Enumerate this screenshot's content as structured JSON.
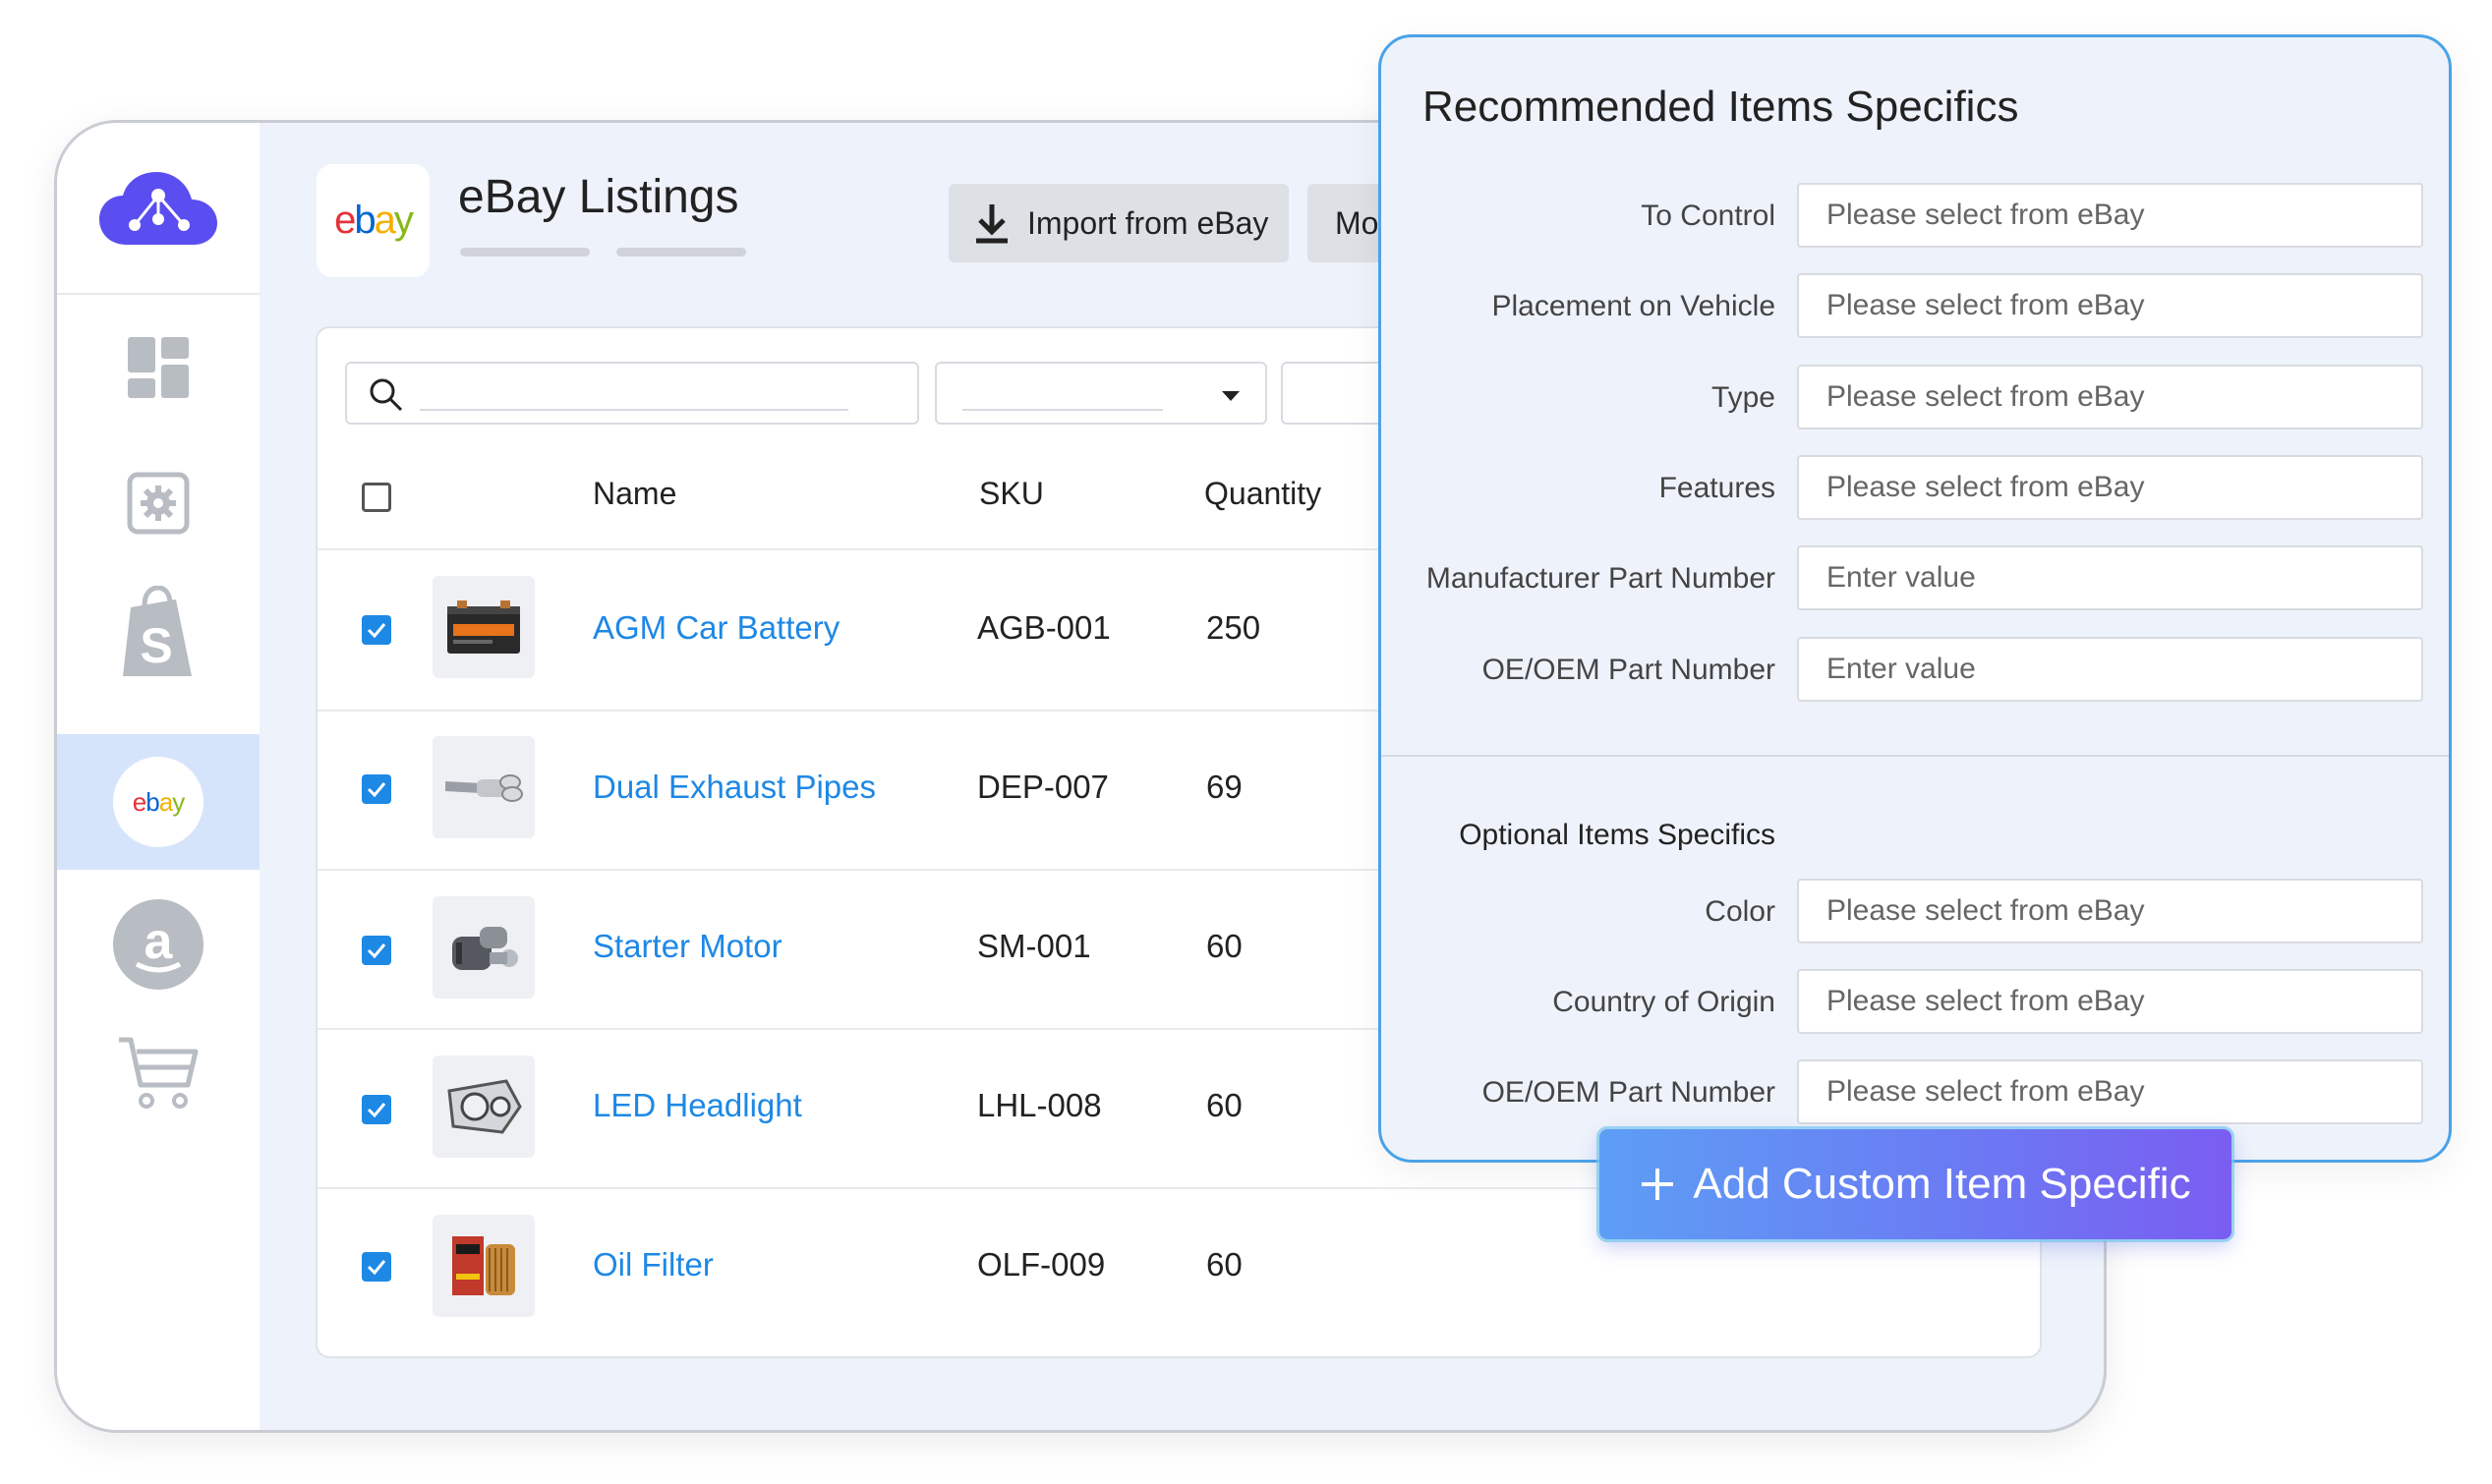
{
  "header": {
    "title": "eBay Listings",
    "import_button": "Import from eBay",
    "more_button": "Mo",
    "ebay_logo": "ebay"
  },
  "sidebar": {
    "items": [
      {
        "icon": "dashboard-icon"
      },
      {
        "icon": "settings-icon"
      },
      {
        "icon": "shopify-icon"
      },
      {
        "icon": "ebay-icon",
        "label": "ebay",
        "active": true
      },
      {
        "icon": "amazon-icon"
      },
      {
        "icon": "cart-icon"
      }
    ]
  },
  "table": {
    "columns": [
      "Name",
      "SKU",
      "Quantity"
    ],
    "rows": [
      {
        "name": "AGM Car Battery",
        "sku": "AGB-001",
        "quantity": "250",
        "checked": true,
        "thumb": "battery-icon"
      },
      {
        "name": "Dual Exhaust Pipes",
        "sku": "DEP-007",
        "quantity": "69",
        "checked": true,
        "thumb": "exhaust-icon"
      },
      {
        "name": "Starter Motor",
        "sku": "SM-001",
        "quantity": "60",
        "checked": true,
        "thumb": "starter-motor-icon"
      },
      {
        "name": "LED Headlight",
        "sku": "LHL-008",
        "quantity": "60",
        "checked": true,
        "thumb": "headlight-icon"
      },
      {
        "name": "Oil Filter",
        "sku": "OLF-009",
        "quantity": "60",
        "checked": true,
        "thumb": "oil-filter-icon"
      }
    ]
  },
  "panel": {
    "title": "Recommended Items Specifics",
    "recommended": [
      {
        "label": "To Control",
        "placeholder": "Please select from eBay"
      },
      {
        "label": "Placement on Vehicle",
        "placeholder": "Please select from eBay"
      },
      {
        "label": "Type",
        "placeholder": "Please select from eBay"
      },
      {
        "label": "Features",
        "placeholder": "Please select from eBay"
      },
      {
        "label": "Manufacturer Part Number",
        "placeholder": "Enter value"
      },
      {
        "label": "OE/OEM Part Number",
        "placeholder": "Enter value"
      }
    ],
    "optional_title": "Optional Items Specifics",
    "optional": [
      {
        "label": "Color",
        "placeholder": "Please select from eBay"
      },
      {
        "label": "Country of Origin",
        "placeholder": "Please select from eBay"
      },
      {
        "label": "OE/OEM Part Number",
        "placeholder": "Please select from eBay"
      }
    ],
    "add_button": "Add Custom Item Specific"
  },
  "colors": {
    "accent": "#1e88e5",
    "sidebar_active": "#d6e4fb",
    "panel_border": "#4aa3e8",
    "logo_purple": "#5b4ef0"
  }
}
